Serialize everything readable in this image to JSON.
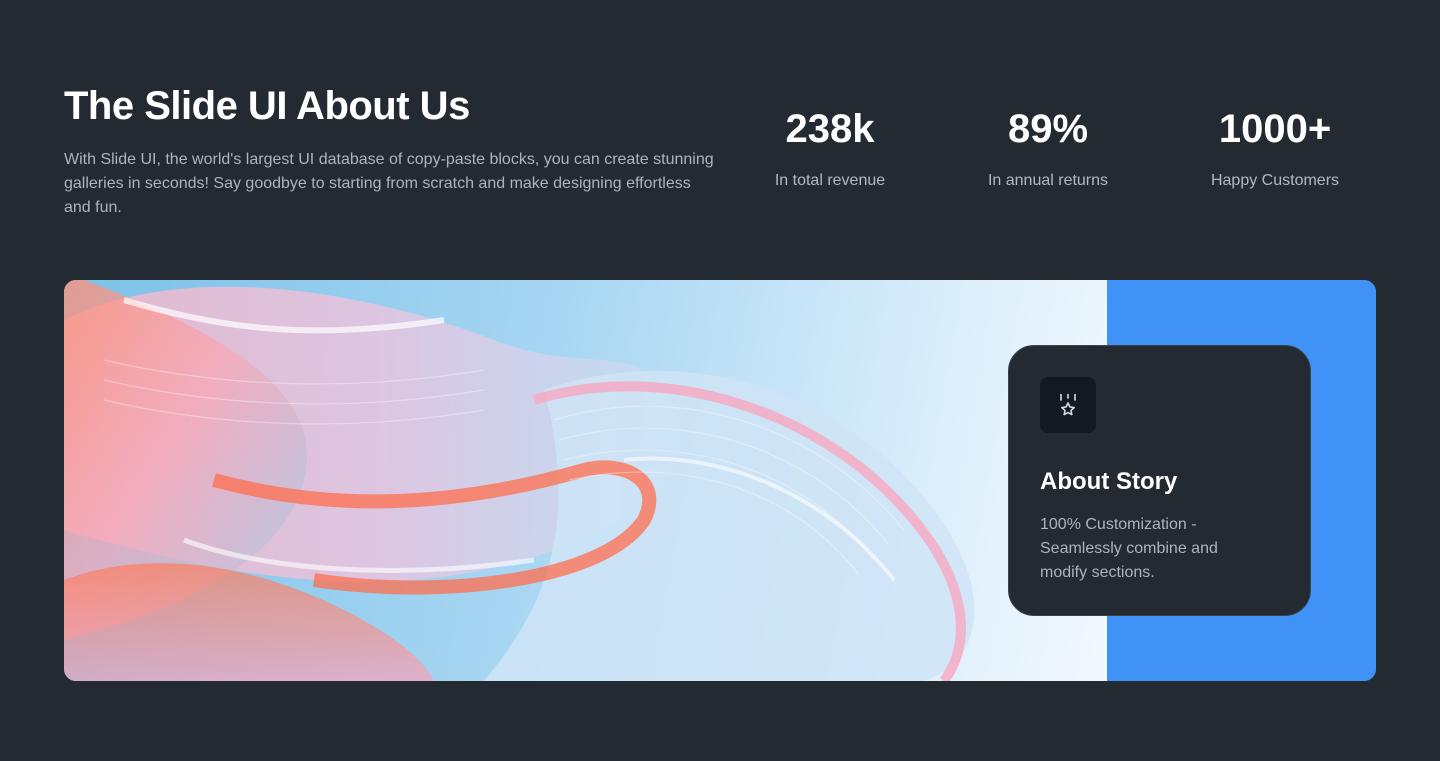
{
  "intro": {
    "title": "The Slide UI About Us",
    "description": "With Slide UI, the world's largest UI database of copy-paste blocks, you can create stunning galleries in seconds! Say goodbye to starting from scratch and make designing effortless and fun."
  },
  "stats": [
    {
      "value": "238k",
      "label": "In total revenue"
    },
    {
      "value": "89%",
      "label": "In annual returns"
    },
    {
      "value": "1000+",
      "label": "Happy Customers"
    }
  ],
  "banner": {
    "image_subject": "abstract glass ribbons",
    "card": {
      "icon": "medal-star-icon",
      "title": "About Story",
      "text": "100% Customization - Seamlessly combine and modify sections."
    }
  },
  "colors": {
    "background": "#242a31",
    "accent": "#3f92f6",
    "card": "#242a31",
    "muted_text": "#aeb4bb"
  }
}
